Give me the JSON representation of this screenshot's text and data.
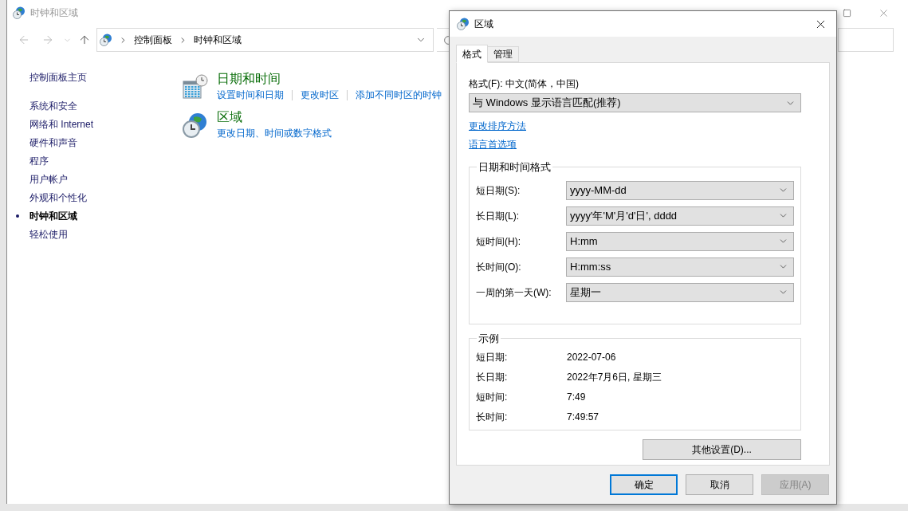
{
  "main_window": {
    "title": "时钟和区域",
    "breadcrumb": [
      "控制面板",
      "时钟和区域"
    ],
    "sidebar": {
      "home": "控制面板主页",
      "items": [
        {
          "label": "系统和安全",
          "selected": false
        },
        {
          "label": "网络和 Internet",
          "selected": false
        },
        {
          "label": "硬件和声音",
          "selected": false
        },
        {
          "label": "程序",
          "selected": false
        },
        {
          "label": "用户帐户",
          "selected": false
        },
        {
          "label": "外观和个性化",
          "selected": false
        },
        {
          "label": "时钟和区域",
          "selected": true
        },
        {
          "label": "轻松使用",
          "selected": false
        }
      ]
    },
    "categories": [
      {
        "kind": "datetime",
        "title": "日期和时间",
        "links": [
          "设置时间和日期",
          "更改时区",
          "添加不同时区的时钟"
        ]
      },
      {
        "kind": "region",
        "title": "区域",
        "links": [
          "更改日期、时间或数字格式"
        ]
      }
    ]
  },
  "dialog": {
    "title": "区域",
    "tabs": [
      {
        "label": "格式",
        "selected": true
      },
      {
        "label": "管理",
        "selected": false
      }
    ],
    "format_label": "格式(F): 中文(简体，中国)",
    "format_value": "与 Windows 显示语言匹配(推荐)",
    "links": [
      "更改排序方法",
      "语言首选项"
    ],
    "formats_group": {
      "title": "日期和时间格式",
      "rows": [
        {
          "label": "短日期(S):",
          "value": "yyyy-MM-dd"
        },
        {
          "label": "长日期(L):",
          "value": "yyyy'年'M'月'd'日', dddd"
        },
        {
          "label": "短时间(H):",
          "value": "H:mm"
        },
        {
          "label": "长时间(O):",
          "value": "H:mm:ss"
        },
        {
          "label": "一周的第一天(W):",
          "value": "星期一"
        }
      ]
    },
    "examples_group": {
      "title": "示例",
      "rows": [
        {
          "label": "短日期:",
          "value": "2022-07-06"
        },
        {
          "label": "长日期:",
          "value": "2022年7月6日, 星期三"
        },
        {
          "label": "短时间:",
          "value": "7:49"
        },
        {
          "label": "长时间:",
          "value": "7:49:57"
        }
      ]
    },
    "more_button": "其他设置(D)...",
    "buttons": [
      {
        "label": "确定",
        "kind": "default",
        "disabled": false
      },
      {
        "label": "取消",
        "kind": "normal",
        "disabled": false
      },
      {
        "label": "应用(A)",
        "kind": "normal",
        "disabled": true
      }
    ]
  }
}
